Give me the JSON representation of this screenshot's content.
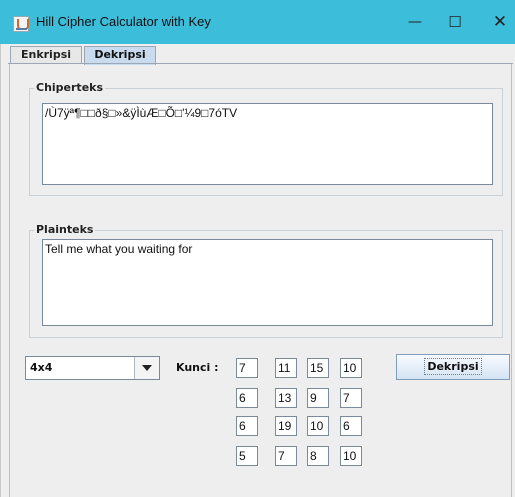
{
  "window": {
    "title": "Hill Cipher Calculator with Key",
    "app_icon": "java-cup-icon",
    "minimize_glyph": "—",
    "maximize_glyph": "☐",
    "close_glyph": "✕"
  },
  "tabs": [
    {
      "label": "Enkripsi",
      "selected": false
    },
    {
      "label": "Dekripsi",
      "selected": true
    }
  ],
  "ciphertext": {
    "label": "Chiperteks",
    "value": "/Ù7ÿª¶□□ð§□»&ÿÌùÆ□Õ□'¼9□7óTV"
  },
  "plaintext": {
    "label": "Plainteks",
    "value": "Tell me what you waiting for"
  },
  "matrix_size": {
    "selected": "4x4"
  },
  "key": {
    "label": "Kunci :",
    "rows": [
      [
        "7",
        "11",
        "15",
        "10"
      ],
      [
        "6",
        "13",
        "9",
        "7"
      ],
      [
        "6",
        "19",
        "10",
        "6"
      ],
      [
        "5",
        "7",
        "8",
        "10"
      ]
    ]
  },
  "action_button": {
    "label": "Dekripsi"
  }
}
